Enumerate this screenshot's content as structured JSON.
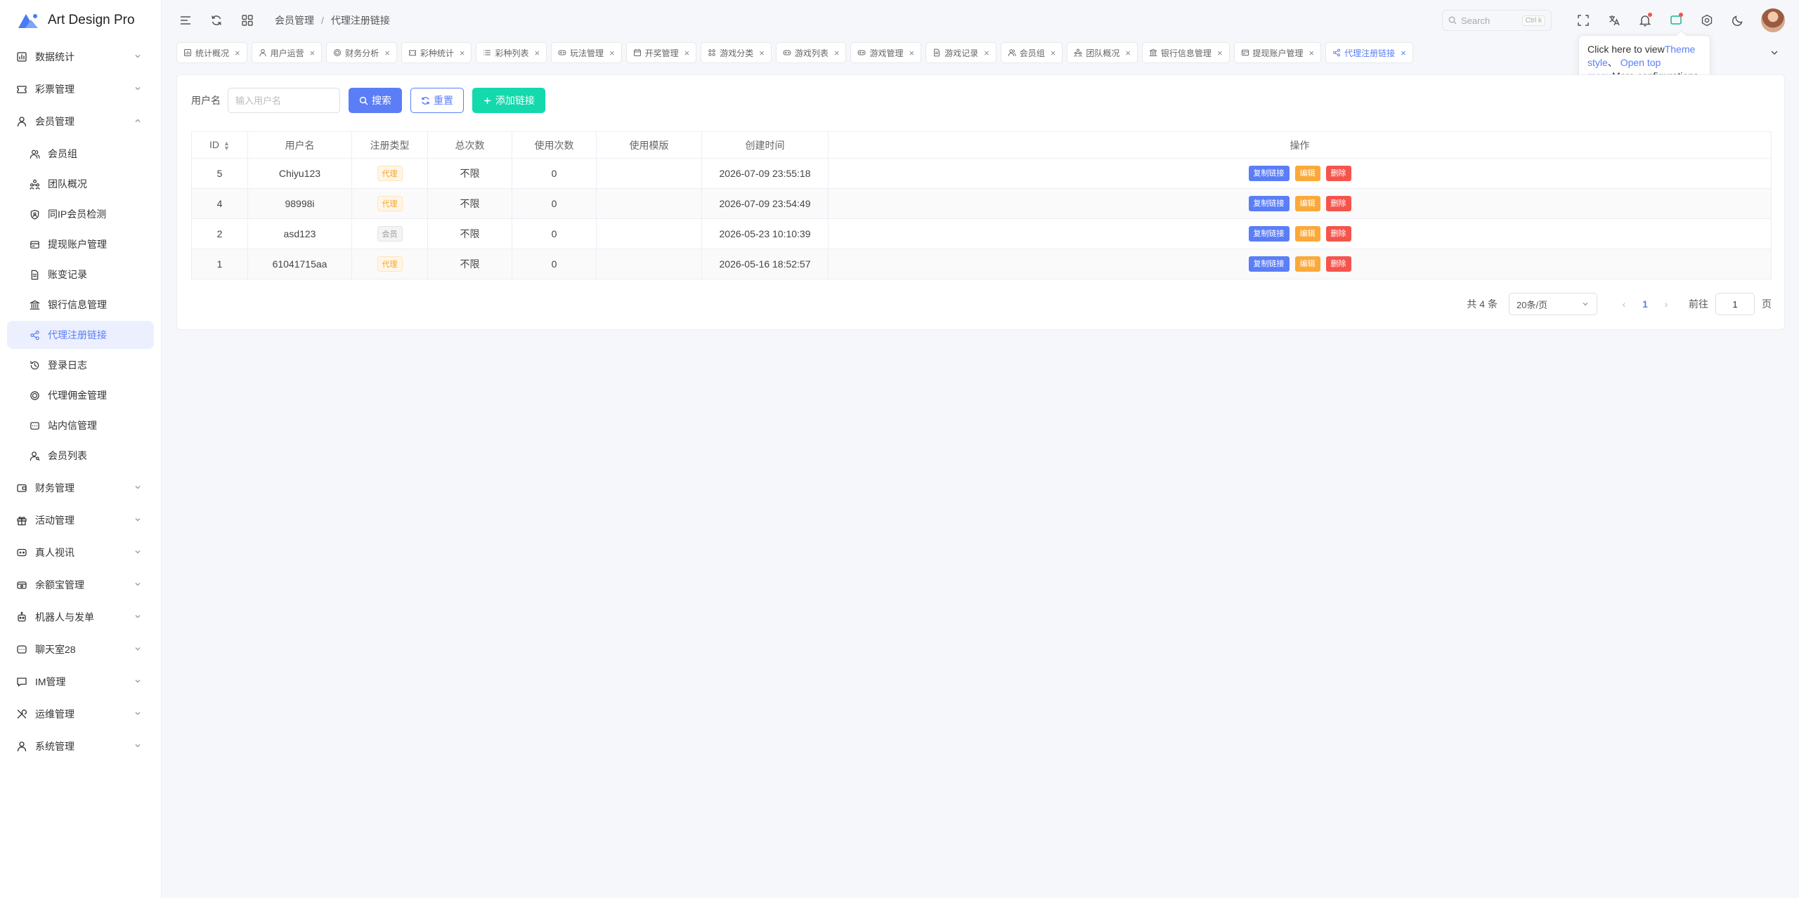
{
  "app": {
    "title": "Art Design Pro"
  },
  "sidebar": {
    "items": [
      {
        "label": "数据统计",
        "icon": "chart-icon"
      },
      {
        "label": "彩票管理",
        "icon": "ticket-icon"
      },
      {
        "label": "会员管理",
        "icon": "user-icon",
        "expanded": true,
        "children": [
          {
            "label": "会员组",
            "icon": "users-icon"
          },
          {
            "label": "团队概况",
            "icon": "team-icon"
          },
          {
            "label": "同IP会员检测",
            "icon": "shield-icon"
          },
          {
            "label": "提现账户管理",
            "icon": "card-icon"
          },
          {
            "label": "账变记录",
            "icon": "file-icon"
          },
          {
            "label": "银行信息管理",
            "icon": "bank-icon"
          },
          {
            "label": "代理注册链接",
            "icon": "share-icon",
            "active": true
          },
          {
            "label": "登录日志",
            "icon": "history-icon"
          },
          {
            "label": "代理佣金管理",
            "icon": "coin-icon"
          },
          {
            "label": "站内信管理",
            "icon": "message-icon"
          },
          {
            "label": "会员列表",
            "icon": "user-search-icon"
          }
        ]
      },
      {
        "label": "财务管理",
        "icon": "wallet-icon"
      },
      {
        "label": "活动管理",
        "icon": "gift-icon"
      },
      {
        "label": "真人视讯",
        "icon": "video-icon"
      },
      {
        "label": "余额宝管理",
        "icon": "piggy-icon"
      },
      {
        "label": "机器人与发单",
        "icon": "robot-icon"
      },
      {
        "label": "聊天室28",
        "icon": "chat-room-icon"
      },
      {
        "label": "IM管理",
        "icon": "im-icon"
      },
      {
        "label": "运维管理",
        "icon": "tools-icon"
      },
      {
        "label": "系统管理",
        "icon": "system-user-icon"
      }
    ]
  },
  "header": {
    "breadcrumb": [
      "会员管理",
      "代理注册链接"
    ],
    "search_placeholder": "Search",
    "search_shortcut": "Ctrl k"
  },
  "tabs": [
    {
      "label": "统计概况",
      "icon": "chart-icon"
    },
    {
      "label": "用户运营",
      "icon": "user-icon"
    },
    {
      "label": "财务分析",
      "icon": "coin-icon"
    },
    {
      "label": "彩种统计",
      "icon": "ticket-icon"
    },
    {
      "label": "彩种列表",
      "icon": "list-icon"
    },
    {
      "label": "玩法管理",
      "icon": "gamepad-icon"
    },
    {
      "label": "开奖管理",
      "icon": "calendar-icon"
    },
    {
      "label": "游戏分类",
      "icon": "grid-icon"
    },
    {
      "label": "游戏列表",
      "icon": "gamepad-icon"
    },
    {
      "label": "游戏管理",
      "icon": "gamepad-icon"
    },
    {
      "label": "游戏记录",
      "icon": "file-icon"
    },
    {
      "label": "会员组",
      "icon": "users-icon"
    },
    {
      "label": "团队概况",
      "icon": "team-icon"
    },
    {
      "label": "银行信息管理",
      "icon": "bank-icon"
    },
    {
      "label": "提现账户管理",
      "icon": "card-icon"
    },
    {
      "label": "代理注册链接",
      "icon": "share-icon",
      "active": true
    }
  ],
  "tooltip": {
    "part1": "Click here to view",
    "link1": "Theme style",
    "part2": "、",
    "link2": "Open top menu",
    "part3": "More configurations"
  },
  "filter": {
    "label": "用户名",
    "placeholder": "输入用户名",
    "search_label": "搜索",
    "reset_label": "重置",
    "add_label": "添加链接"
  },
  "table": {
    "columns": [
      "ID",
      "用户名",
      "注册类型",
      "总次数",
      "使用次数",
      "使用模版",
      "创建时间",
      "操作"
    ],
    "rows": [
      {
        "id": "5",
        "username": "Chiyu123",
        "type": "代理",
        "type_kind": "agent",
        "total": "不限",
        "used": "0",
        "template": "",
        "created": "2026-07-09 23:55:18"
      },
      {
        "id": "4",
        "username": "98998i",
        "type": "代理",
        "type_kind": "agent",
        "total": "不限",
        "used": "0",
        "template": "",
        "created": "2026-07-09 23:54:49"
      },
      {
        "id": "2",
        "username": "asd123",
        "type": "会员",
        "type_kind": "member",
        "total": "不限",
        "used": "0",
        "template": "",
        "created": "2026-05-23 10:10:39"
      },
      {
        "id": "1",
        "username": "61041715aa",
        "type": "代理",
        "type_kind": "agent",
        "total": "不限",
        "used": "0",
        "template": "",
        "created": "2026-05-16 18:52:57"
      }
    ],
    "actions": {
      "copy": "复制链接",
      "edit": "编辑",
      "delete": "删除"
    }
  },
  "pagination": {
    "total_text": "共 4 条",
    "page_size": "20条/页",
    "current_page": "1",
    "goto_label": "前往",
    "goto_value": "1",
    "page_suffix": "页"
  },
  "colors": {
    "primary": "#5b7ef7",
    "success": "#13d9ac",
    "warning": "#fba93a",
    "danger": "#f5544d"
  }
}
